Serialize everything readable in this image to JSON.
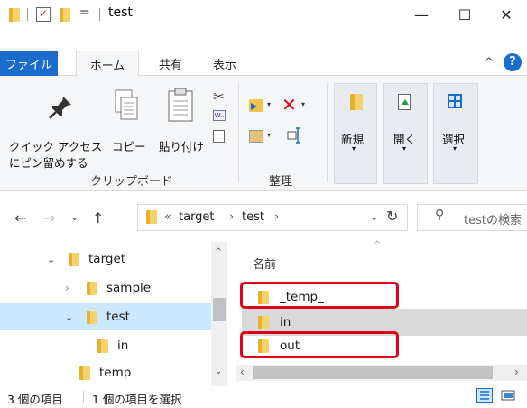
{
  "window": {
    "title": "test",
    "qat_dropdown": "=",
    "minimize": "—",
    "maximize": "☐",
    "close": "✕"
  },
  "tabs": {
    "file": "ファイル",
    "home": "ホーム",
    "share": "共有",
    "view": "表示",
    "collapse": "^",
    "help": "?"
  },
  "ribbon": {
    "clipboard": {
      "pin_label_1": "クイック アクセス",
      "pin_label_2": "にピン留めする",
      "copy": "コピー",
      "paste": "貼り付け",
      "group": "クリップボード"
    },
    "organize": {
      "group": "整理"
    },
    "new_open_select": {
      "new": "新規",
      "open": "開く",
      "select": "選択"
    }
  },
  "address": {
    "prefix": "«",
    "crumb1": "target",
    "crumb2": "test",
    "search_placeholder": "testの検索"
  },
  "nav_tree": [
    {
      "label": "target"
    },
    {
      "label": "sample"
    },
    {
      "label": "test"
    },
    {
      "label": "in"
    },
    {
      "label": "temp"
    }
  ],
  "content": {
    "column_name": "名前",
    "items": [
      {
        "label": "_temp_"
      },
      {
        "label": "in"
      },
      {
        "label": "out"
      }
    ]
  },
  "status": {
    "count": "3 個の項目",
    "selected": "1 個の項目を選択"
  }
}
